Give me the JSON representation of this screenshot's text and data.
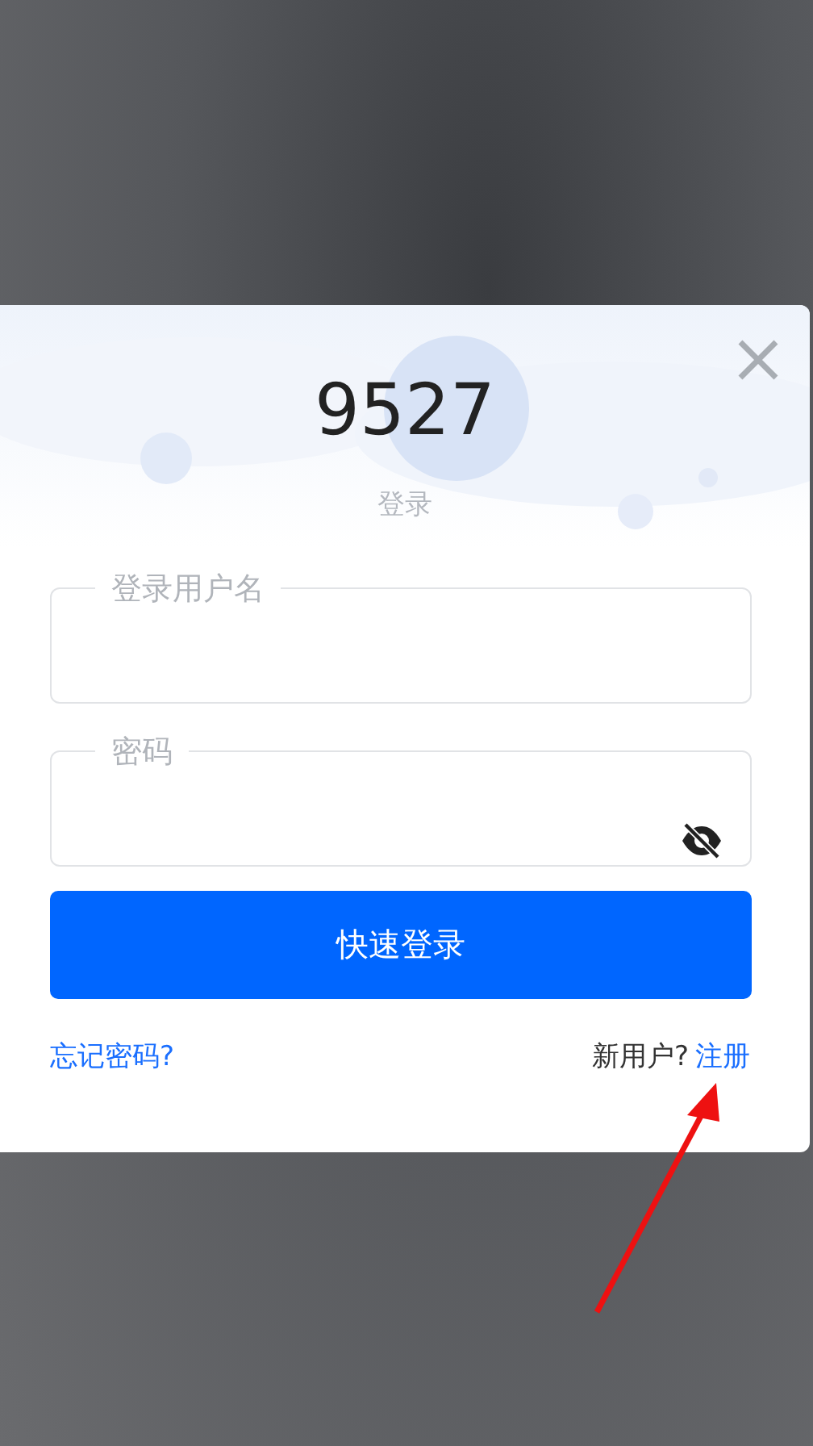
{
  "dialog": {
    "title": "9527",
    "subtitle": "登录"
  },
  "fields": [
    {
      "label": "登录用户名",
      "kind": "text"
    },
    {
      "label": "密码",
      "kind": "password"
    }
  ],
  "submit_button": "快速登录",
  "forgot_link": "忘记密码?",
  "signup_prompt": "新用户?",
  "signup_link": "注册"
}
